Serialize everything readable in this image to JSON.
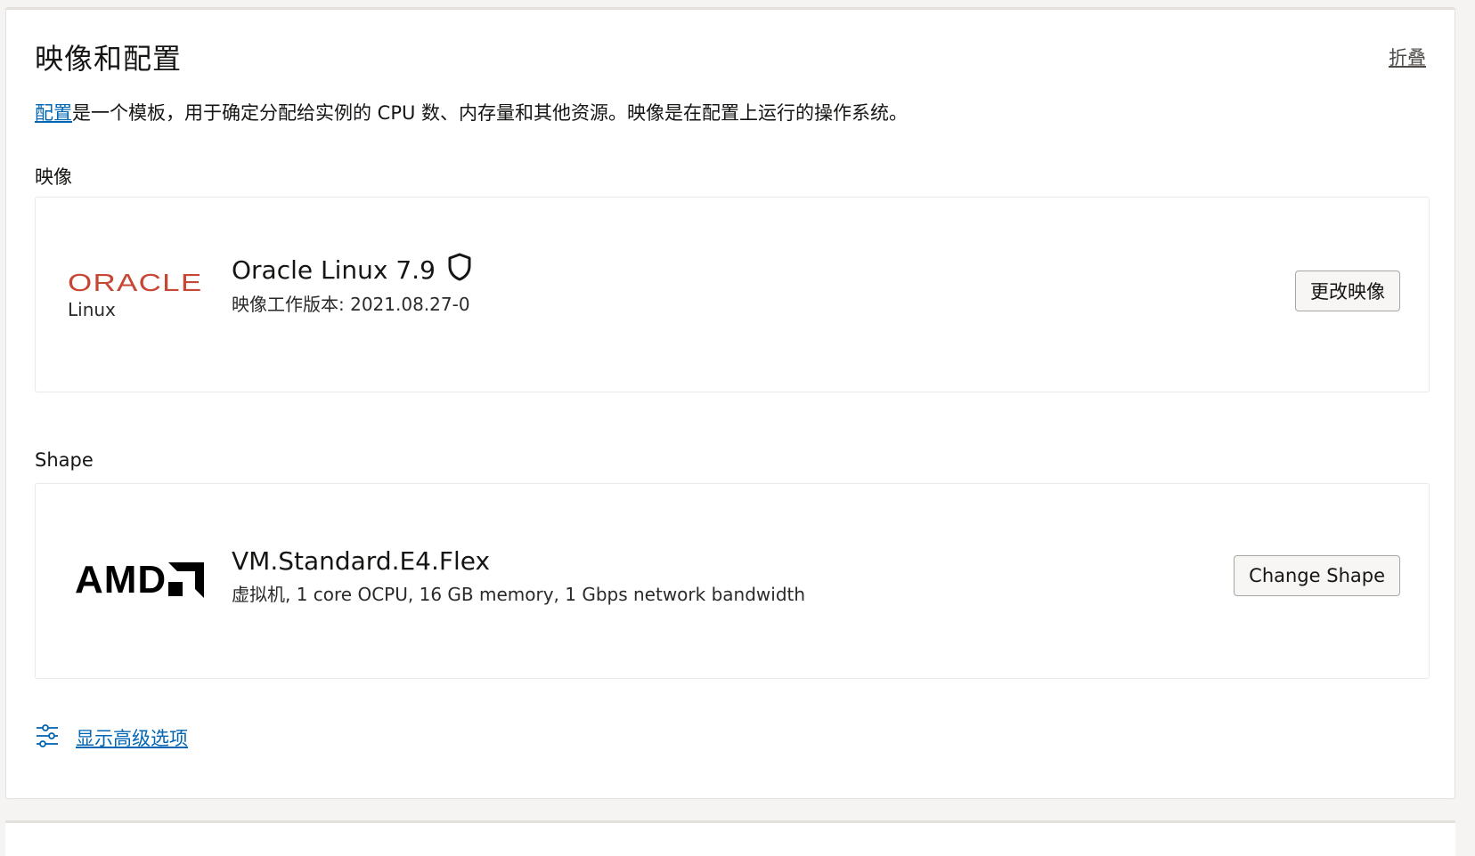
{
  "section": {
    "title": "映像和配置",
    "collapse_label": "折叠",
    "description_link": "配置",
    "description_rest": "是一个模板，用于确定分配给实例的 CPU 数、内存量和其他资源。映像是在配置上运行的操作系统。"
  },
  "image": {
    "label": "映像",
    "logo_text": "ORACLE",
    "logo_sub": "Linux",
    "name": "Oracle Linux 7.9",
    "build": "映像工作版本: 2021.08.27-0",
    "button": "更改映像",
    "icon": "shield-icon"
  },
  "shape": {
    "label": "Shape",
    "logo_text": "AMD",
    "name": "VM.Standard.E4.Flex",
    "details": "虚拟机, 1 core OCPU, 16 GB memory, 1 Gbps network bandwidth",
    "button": "Change Shape"
  },
  "advanced": {
    "label": "显示高级选项",
    "icon": "sliders-icon"
  },
  "colors": {
    "link": "#0066b4",
    "oracle_red": "#c74634"
  }
}
